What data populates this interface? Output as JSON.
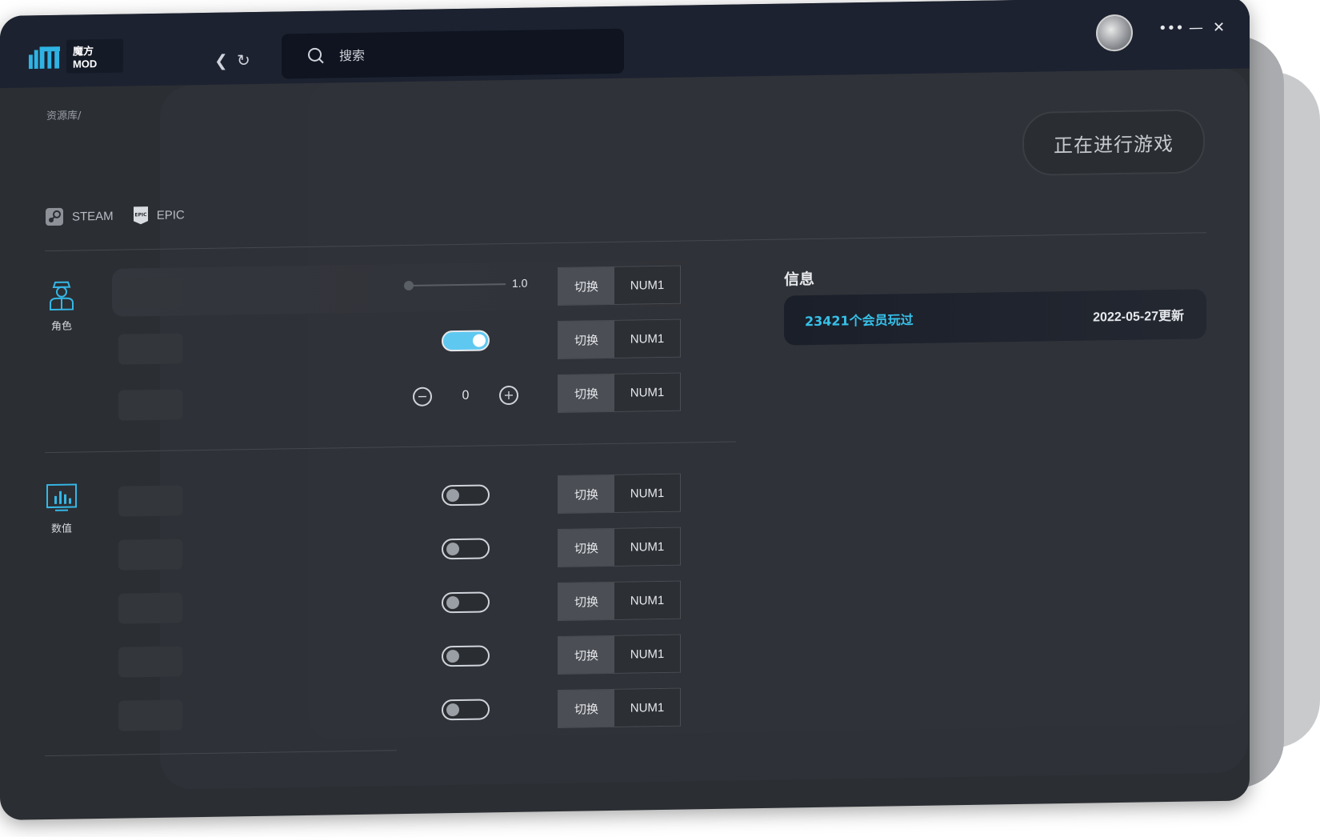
{
  "app": {
    "logo_text": "魔方MOD"
  },
  "search": {
    "placeholder": "搜索"
  },
  "breadcrumb": "资源库/",
  "playing_button": "正在进行游戏",
  "platforms": [
    {
      "name": "STEAM",
      "icon": "steam-icon"
    },
    {
      "name": "EPIC",
      "icon": "epic-icon"
    }
  ],
  "categories": [
    {
      "label": "角色",
      "icon": "character-icon"
    },
    {
      "label": "数值",
      "icon": "stats-chart-icon"
    }
  ],
  "controls": {
    "slider_value": "1.0",
    "slider_level": 0.0,
    "stepper_value": "0",
    "switch_label": "切换",
    "key_label": "NUM1"
  },
  "toggles": {
    "row2": true,
    "row4": false,
    "row5": false,
    "row6": false,
    "row7": false,
    "row8": false
  },
  "info": {
    "title": "信息",
    "players": "23421个会员玩过",
    "updated": "2022-05-27更新"
  },
  "colors": {
    "accent": "#37c0e8",
    "toggle_on": "#5fc8f0",
    "background": "#2b2e33",
    "titlebar": "#1c2230"
  }
}
